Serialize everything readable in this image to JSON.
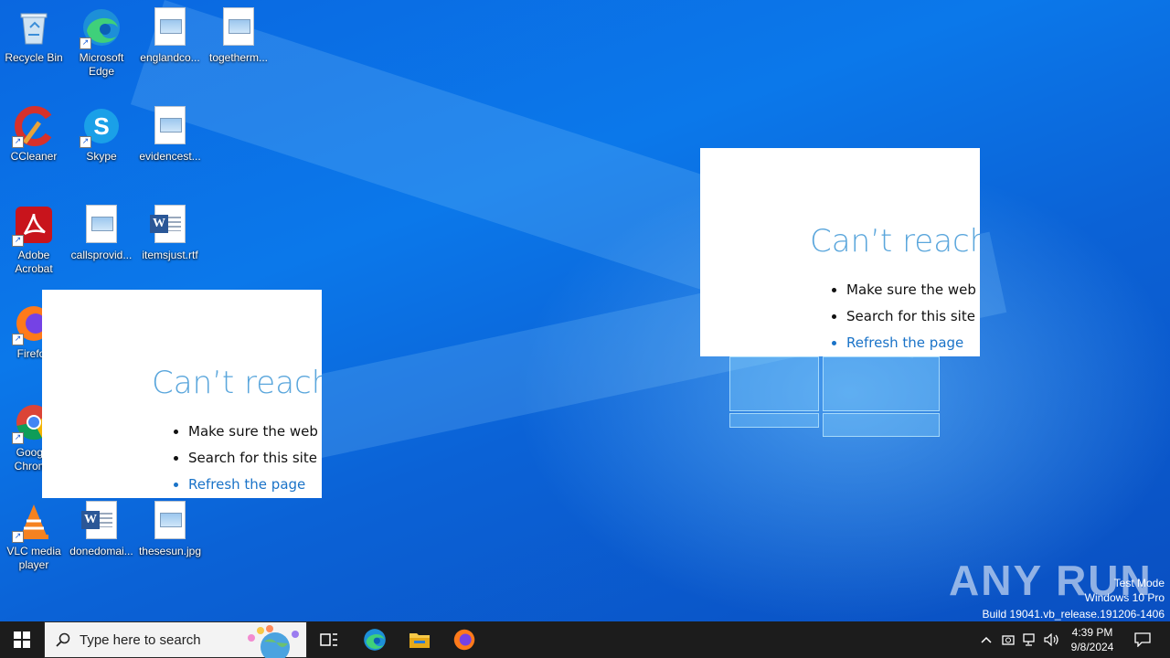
{
  "desktop": {
    "icons": [
      {
        "label": "Recycle Bin"
      },
      {
        "label": "Microsoft Edge"
      },
      {
        "label": "englandco..."
      },
      {
        "label": "togetherm..."
      },
      {
        "label": "CCleaner"
      },
      {
        "label": "Skype"
      },
      {
        "label": "evidencest..."
      },
      {
        "label": "Adobe Acrobat"
      },
      {
        "label": "callsprovid..."
      },
      {
        "label": "itemsjust.rtf"
      },
      {
        "label": "Firefox"
      },
      {
        "label": "Google Chrome"
      },
      {
        "label": "VLC media player"
      },
      {
        "label": "donedomai..."
      },
      {
        "label": "thesesun.jpg"
      }
    ]
  },
  "popups": [
    {
      "title": "Can’t reach t",
      "items": [
        "Make sure the web ad",
        "Search for this site on",
        "Refresh the page"
      ]
    },
    {
      "title": "Can’t reach t",
      "items": [
        "Make sure the web ad",
        "Search for this site on",
        "Refresh the page"
      ]
    }
  ],
  "watermark": {
    "brand": "ANY RUN",
    "line1": "Test Mode",
    "line2": "Windows 10 Pro",
    "line3": "Build 19041.vb_release.191206-1406"
  },
  "taskbar": {
    "search_placeholder": "Type here to search",
    "time": "4:39 PM",
    "date": "9/8/2024"
  },
  "colors": {
    "taskbar": "#1c1c1c",
    "link": "#1a73c8",
    "error_title": "#5aa6dc",
    "wallpaper": "#0b78ea"
  }
}
